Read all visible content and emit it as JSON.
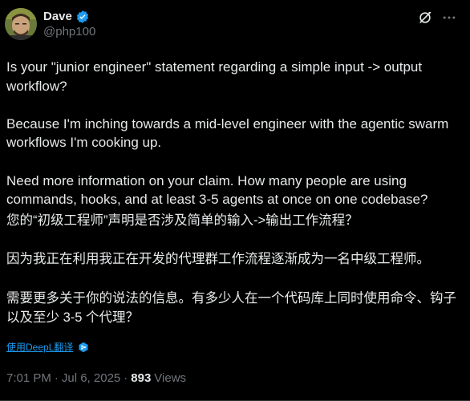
{
  "author": {
    "display_name": "Dave",
    "handle": "@php100",
    "verified": true
  },
  "icons": {
    "avatar": "avatar-portrait",
    "verified": "verified-badge-icon",
    "grok": "grok-icon",
    "more": "more-options-icon",
    "deepl": "deepl-icon"
  },
  "tweet": {
    "paragraphs": [
      "Is your \"junior engineer\" statement regarding a simple input -> output workflow?",
      "Because I'm inching towards a mid-level engineer with the agentic swarm workflows I'm cooking up.",
      "Need more information on your claim. How many people are using commands, hooks, and at least 3-5 agents at once on one codebase?"
    ],
    "translation": [
      "您的“初级工程师”声明是否涉及简单的输入->输出工作流程？",
      "因为我正在利用我正在开发的代理群工作流程逐渐成为一名中级工程师。",
      "需要更多关于你的说法的信息。有多少人在一个代码库上同时使用命令、钩子以及至少 3-5 个代理？"
    ],
    "translate_label": "使用DeepL翻译",
    "time": "7:01 PM",
    "separator1": "·",
    "date": "Jul 6, 2025",
    "separator2": "·",
    "views_count": "893",
    "views_label": "Views"
  },
  "colors": {
    "background": "#000000",
    "text": "#e7e9ea",
    "secondary": "#71767b",
    "accent": "#1d9bf0",
    "divider": "#2f3336"
  }
}
